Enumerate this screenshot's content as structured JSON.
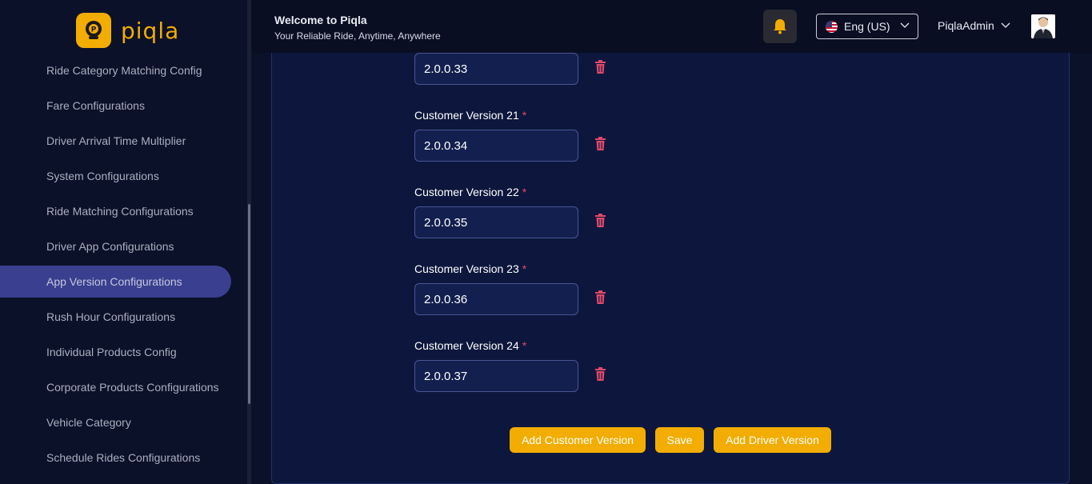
{
  "app": {
    "brand": "piqla",
    "colors": {
      "accent": "#f2ad00",
      "sidebar_active": "#3a3f8f",
      "danger": "#e2486a"
    }
  },
  "sidebar": {
    "items": [
      {
        "label": "Ride Category Matching Config"
      },
      {
        "label": "Fare Configurations"
      },
      {
        "label": "Driver Arrival Time Multiplier"
      },
      {
        "label": "System Configurations"
      },
      {
        "label": "Ride Matching Configurations"
      },
      {
        "label": "Driver App Configurations"
      },
      {
        "label": "App Version Configurations",
        "active": true
      },
      {
        "label": "Rush Hour Configurations"
      },
      {
        "label": "Individual Products Config"
      },
      {
        "label": "Corporate Products Configurations"
      },
      {
        "label": "Vehicle Category"
      },
      {
        "label": "Schedule Rides Configurations"
      }
    ]
  },
  "header": {
    "welcome_title": "Welcome to Piqla",
    "welcome_subtitle": "Your Reliable Ride, Anytime, Anywhere",
    "language": "Eng (US)",
    "user_name": "PiqlaAdmin",
    "icons": {
      "bell": "bell-icon",
      "chevron": "chevron-down-icon"
    }
  },
  "form": {
    "fields": [
      {
        "label": "",
        "value": "2.0.0.33"
      },
      {
        "label": "Customer Version 21",
        "value": "2.0.0.34"
      },
      {
        "label": "Customer Version 22",
        "value": "2.0.0.35"
      },
      {
        "label": "Customer Version 23",
        "value": "2.0.0.36"
      },
      {
        "label": "Customer Version 24",
        "value": "2.0.0.37"
      }
    ],
    "required_mark": "*",
    "buttons": {
      "add_customer": "Add Customer Version",
      "save": "Save",
      "add_driver": "Add Driver Version"
    }
  }
}
